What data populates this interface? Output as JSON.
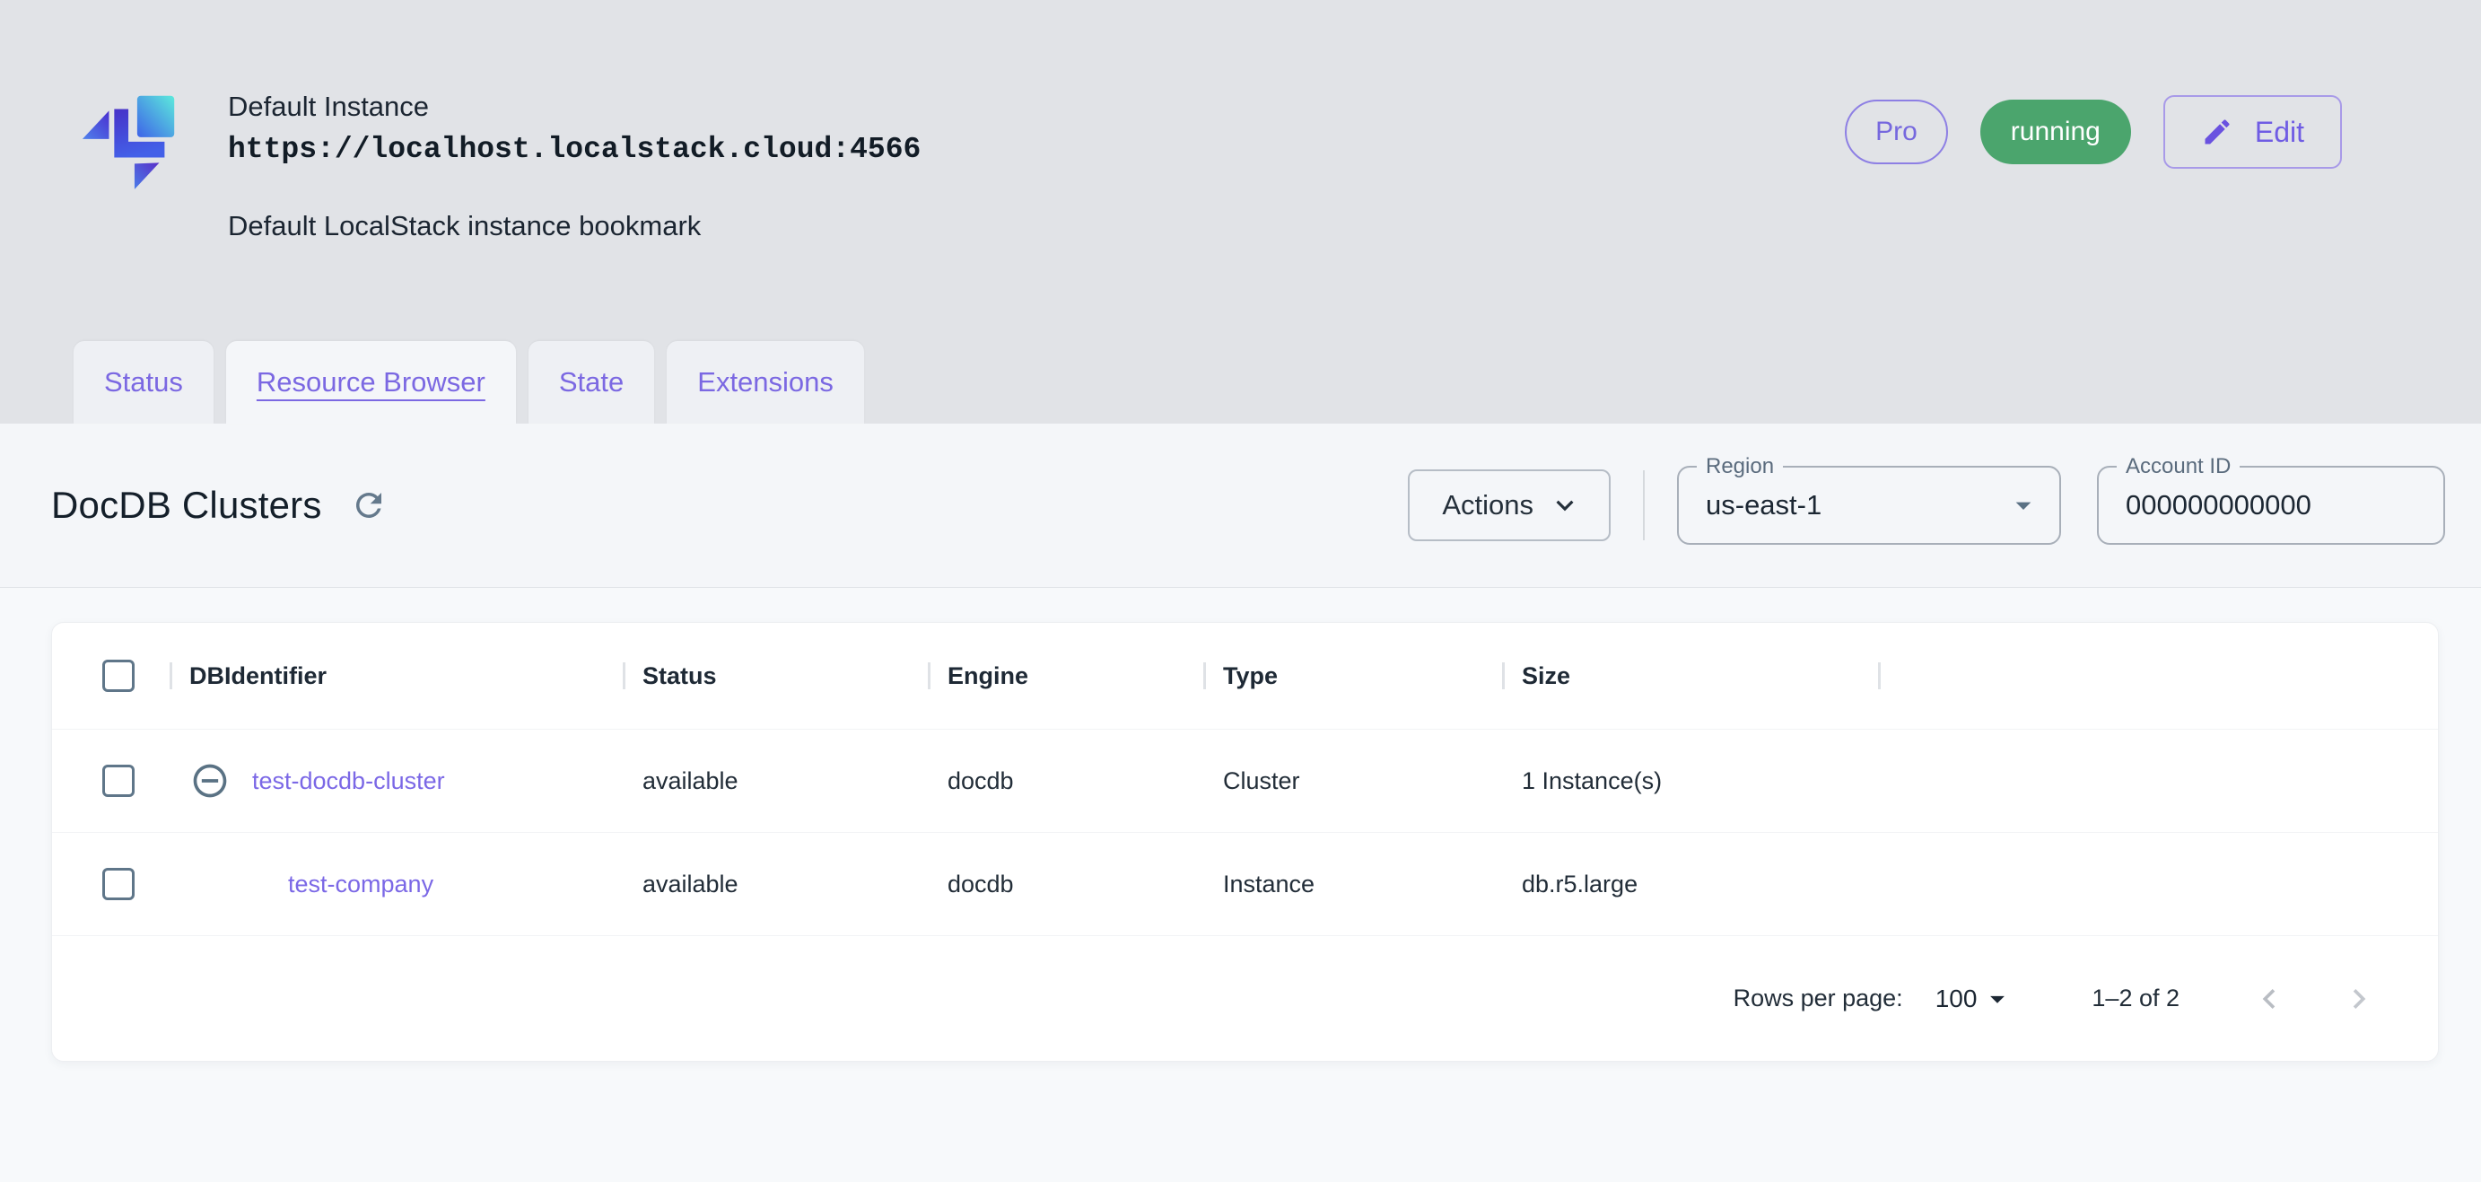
{
  "header": {
    "title": "Default Instance",
    "url": "https://localhost.localstack.cloud:4566",
    "subtitle": "Default LocalStack instance bookmark",
    "pro_badge": "Pro",
    "status_badge": "running",
    "edit_button": "Edit"
  },
  "tabs": [
    {
      "label": "Status",
      "active": false
    },
    {
      "label": "Resource Browser",
      "active": true
    },
    {
      "label": "State",
      "active": false
    },
    {
      "label": "Extensions",
      "active": false
    }
  ],
  "toolbar": {
    "page_title": "DocDB Clusters",
    "actions_button": "Actions",
    "region_label": "Region",
    "region_value": "us-east-1",
    "account_label": "Account ID",
    "account_value": "000000000000"
  },
  "table": {
    "columns": [
      "DBIdentifier",
      "Status",
      "Engine",
      "Type",
      "Size"
    ],
    "rows": [
      {
        "id": "test-docdb-cluster",
        "status": "available",
        "engine": "docdb",
        "type": "Cluster",
        "size": "1 Instance(s)",
        "expandable": true
      },
      {
        "id": "test-company",
        "status": "available",
        "engine": "docdb",
        "type": "Instance",
        "size": "db.r5.large",
        "expandable": false
      }
    ]
  },
  "pagination": {
    "rows_per_page_label": "Rows per page:",
    "rows_per_page_value": "100",
    "range": "1–2 of 2"
  },
  "colors": {
    "accent_purple": "#7b68e2",
    "status_green": "#4ba56d",
    "header_gray": "#e1e3e7",
    "slate_icon": "#5f7689"
  }
}
